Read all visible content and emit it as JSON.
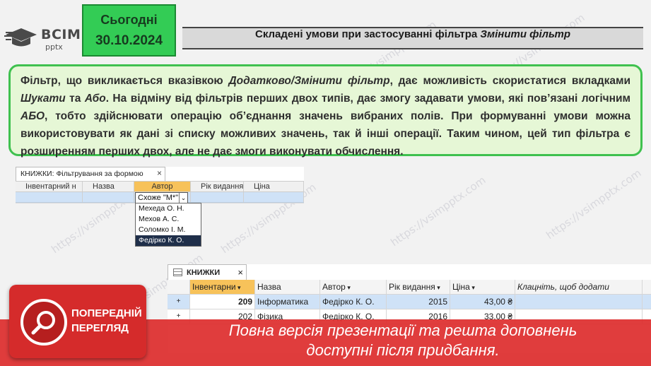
{
  "header": {
    "logo_text": "ВСІМ",
    "logo_sub": "pptx",
    "date_label": "Сьогодні",
    "date_value": "30.10.2024",
    "title_plain": "Складені умови при застосуванні фільтра ",
    "title_italic": "Змінити фільтр"
  },
  "description": {
    "p1": "Фільтр, що викликається вказівкою ",
    "p1_italic": "Додатково/Змінити фільтр",
    "p2": ", дає можливість скористатися вкладками ",
    "p2_italic": "Шукати",
    "p3": " та ",
    "p3_italic": "Або",
    "p4": ". На відміну від фільтрів перших двох типів, дає змогу задавати умови, які пов’язані логічним ",
    "p4_italic": "АБО",
    "p5": ", тобто здійснювати операцію об’єднання значень вибраних полів. При формуванні умови можна використовувати як дані зі списку можливих значень, так й інші операції. Таким чином, цей тип фільтра є розширенням перших двох, але не дає змоги виконувати обчислення."
  },
  "filter_form": {
    "tab_title": "КНИЖКИ: Фільтрування за формою",
    "close": "×",
    "columns": [
      "Інвентарний н",
      "Назва",
      "Автор",
      "Рік видання",
      "Ціна"
    ],
    "combo_value": "Схоже \"М*\"",
    "combo_arrow": "⌄",
    "options": [
      "Мехеда О. Н.",
      "Мехов А. С.",
      "Соломко І. М.",
      "Федірко К. О."
    ]
  },
  "table": {
    "tab_title": "КНИЖКИ",
    "close": "×",
    "columns": [
      "Інвентарни",
      "Назва",
      "Автор",
      "Рік видання",
      "Ціна",
      "Клацніть, щоб додати"
    ],
    "rows": [
      {
        "expand": "+",
        "id": "209",
        "name": "Інформатика",
        "author": "Федірко К. О.",
        "year": "2015",
        "price": "43,00 ₴"
      },
      {
        "expand": "+",
        "id": "202",
        "name": "Фізика",
        "author": "Федірко К. О.",
        "year": "2016",
        "price": "33,00 ₴"
      }
    ]
  },
  "preview": {
    "badge_line1": "ПОПЕРЕДНІЙ",
    "badge_line2": "ПЕРЕГЛЯД",
    "band_line1": "Повна версія презентації та решта доповнень",
    "band_line2": "доступні після придбання."
  },
  "watermark": "https://vsimpptx.com",
  "colors": {
    "date_green": "#33cc55",
    "desc_bg": "#e6f7d6",
    "desc_border": "#3fc14f",
    "active_header": "#f7c25a",
    "selection_blue": "#cfe2f7",
    "preview_red": "#d52b2b"
  }
}
